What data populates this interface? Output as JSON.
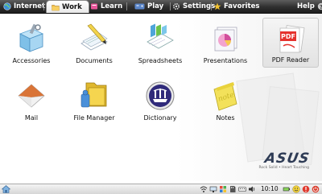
{
  "tabs": [
    {
      "label": "Internet",
      "icon": "globe-icon"
    },
    {
      "label": "Work",
      "icon": "folder-icon",
      "active": true
    },
    {
      "label": "Learn",
      "icon": "learn-icon"
    },
    {
      "label": "Play",
      "icon": "play-icon"
    },
    {
      "label": "Settings",
      "icon": "settings-icon"
    },
    {
      "label": "Favorites",
      "icon": "star-icon"
    },
    {
      "label": "Help",
      "icon": "help-icon"
    }
  ],
  "apps": [
    {
      "label": "Accessories",
      "icon": "accessories-icon"
    },
    {
      "label": "Documents",
      "icon": "documents-icon"
    },
    {
      "label": "Spreadsheets",
      "icon": "spreadsheets-icon"
    },
    {
      "label": "Presentations",
      "icon": "presentations-icon"
    },
    {
      "label": "PDF Reader",
      "icon": "pdf-reader-icon",
      "selected": true
    },
    {
      "label": "Mail",
      "icon": "mail-icon"
    },
    {
      "label": "File Manager",
      "icon": "file-manager-icon"
    },
    {
      "label": "Dictionary",
      "icon": "dictionary-icon"
    },
    {
      "label": "Notes",
      "icon": "notes-icon",
      "icon_text": "note"
    }
  ],
  "pdf_icon_text": "PDF",
  "brand": {
    "name": "ASUS",
    "tagline": "Rock Solid • Heart Touching"
  },
  "taskbar": {
    "clock": "10:10"
  }
}
